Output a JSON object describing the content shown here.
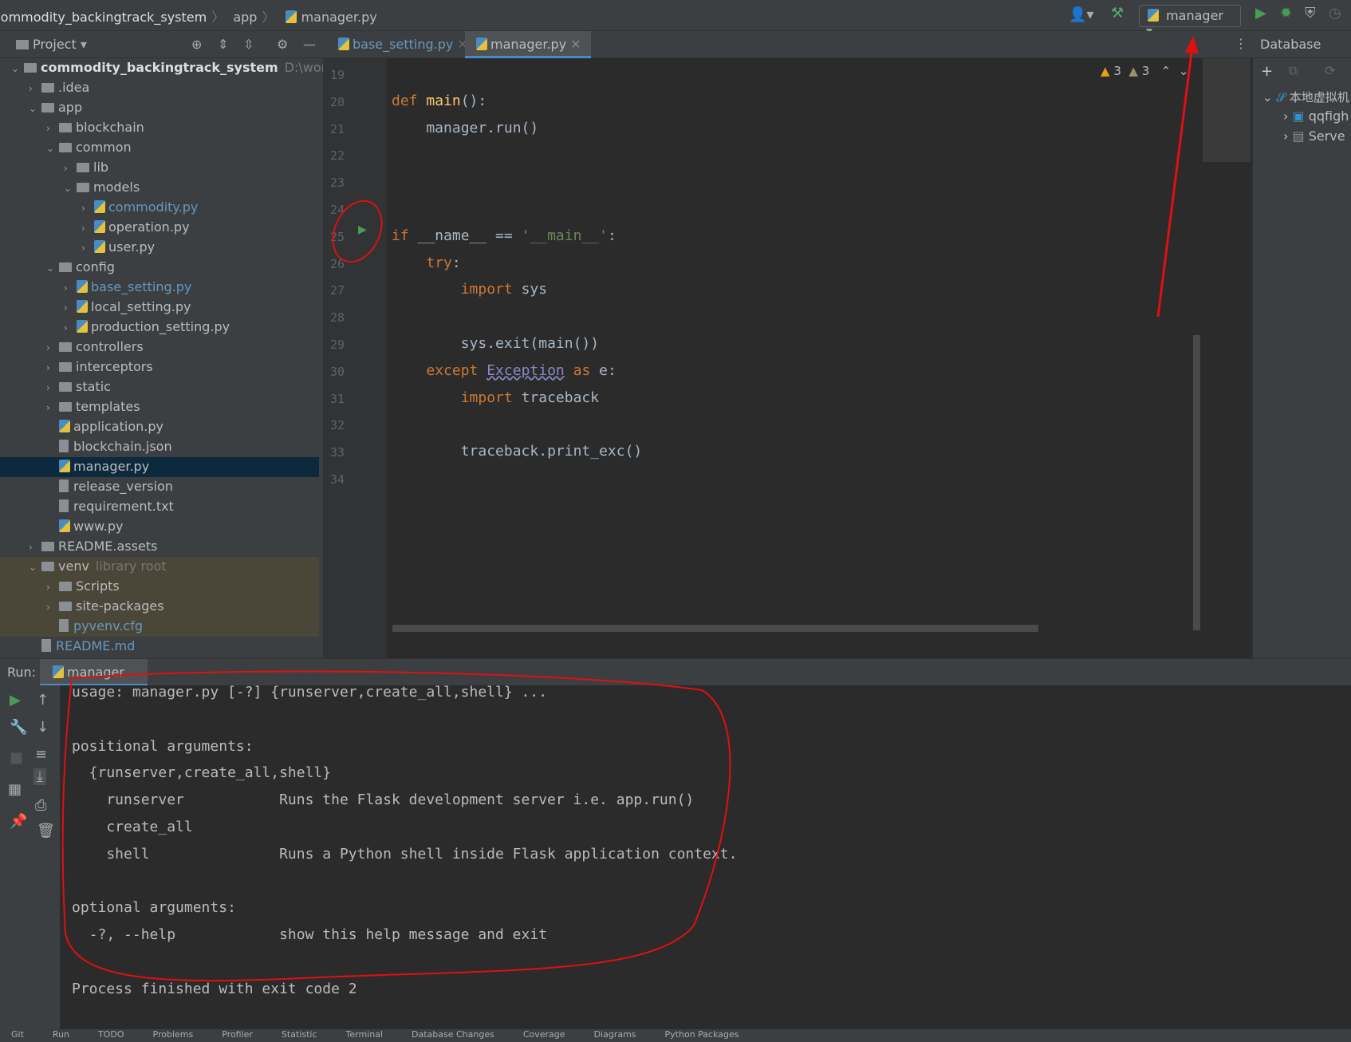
{
  "breadcrumb": [
    "commodity_backingtrack_system",
    "app",
    "manager.py"
  ],
  "run_config": "manager",
  "tabs": [
    {
      "label": "base_setting.py",
      "active": false
    },
    {
      "label": "manager.py",
      "active": true
    }
  ],
  "project": {
    "title": "Project",
    "items": [
      {
        "label": "commodity_backingtrack_system",
        "suffix": "D:\\workspac",
        "depth": 0,
        "open": true,
        "type": "folder"
      },
      {
        "label": ".idea",
        "depth": 1,
        "type": "folder"
      },
      {
        "label": "app",
        "depth": 1,
        "open": true,
        "type": "folder"
      },
      {
        "label": "blockchain",
        "depth": 2,
        "type": "folder"
      },
      {
        "label": "common",
        "depth": 2,
        "open": true,
        "type": "folder"
      },
      {
        "label": "lib",
        "depth": 3,
        "type": "folder"
      },
      {
        "label": "models",
        "depth": 3,
        "open": true,
        "type": "folder"
      },
      {
        "label": "commodity.py",
        "depth": 4,
        "type": "py",
        "color": "#6897bb"
      },
      {
        "label": "operation.py",
        "depth": 4,
        "type": "py"
      },
      {
        "label": "user.py",
        "depth": 4,
        "type": "py"
      },
      {
        "label": "config",
        "depth": 2,
        "open": true,
        "type": "folder"
      },
      {
        "label": "base_setting.py",
        "depth": 3,
        "type": "py",
        "color": "#6897bb"
      },
      {
        "label": "local_setting.py",
        "depth": 3,
        "type": "py"
      },
      {
        "label": "production_setting.py",
        "depth": 3,
        "type": "py"
      },
      {
        "label": "controllers",
        "depth": 2,
        "type": "folder"
      },
      {
        "label": "interceptors",
        "depth": 2,
        "type": "folder"
      },
      {
        "label": "static",
        "depth": 2,
        "type": "folder"
      },
      {
        "label": "templates",
        "depth": 2,
        "type": "folder"
      },
      {
        "label": "application.py",
        "depth": 2,
        "type": "py",
        "leaf": true
      },
      {
        "label": "blockchain.json",
        "depth": 2,
        "type": "txt",
        "leaf": true
      },
      {
        "label": "manager.py",
        "depth": 2,
        "type": "py",
        "leaf": true,
        "selected": true
      },
      {
        "label": "release_version",
        "depth": 2,
        "type": "txt",
        "leaf": true
      },
      {
        "label": "requirement.txt",
        "depth": 2,
        "type": "txt",
        "leaf": true
      },
      {
        "label": "www.py",
        "depth": 2,
        "type": "py",
        "leaf": true
      },
      {
        "label": "README.assets",
        "depth": 1,
        "type": "folder"
      },
      {
        "label": "venv",
        "suffix": "library root",
        "depth": 1,
        "open": true,
        "type": "folder",
        "venv": true
      },
      {
        "label": "Scripts",
        "depth": 2,
        "type": "folder",
        "venv": true
      },
      {
        "label": "site-packages",
        "depth": 2,
        "type": "folder",
        "venv": true
      },
      {
        "label": "pyvenv.cfg",
        "depth": 2,
        "type": "txt",
        "leaf": true,
        "venv": true,
        "color": "#6897bb"
      },
      {
        "label": "README.md",
        "depth": 1,
        "type": "txt",
        "leaf": true,
        "color": "#6897bb"
      }
    ]
  },
  "editor": {
    "warnings": [
      "3",
      "3"
    ],
    "lines": [
      {
        "n": "19",
        "html": ""
      },
      {
        "n": "20",
        "html": "<span class='kw'>def </span><span class='fn'>main</span>():"
      },
      {
        "n": "21",
        "html": "    manager.run()"
      },
      {
        "n": "22",
        "html": ""
      },
      {
        "n": "23",
        "html": ""
      },
      {
        "n": "24",
        "html": ""
      },
      {
        "n": "25",
        "html": "<span class='kw'>if </span>__name__ == <span class='str'>'__main__'</span>:"
      },
      {
        "n": "26",
        "html": "    <span class='kw'>try</span>:"
      },
      {
        "n": "27",
        "html": "        <span class='kw'>import </span>sys"
      },
      {
        "n": "28",
        "html": ""
      },
      {
        "n": "29",
        "html": "        sys.exit(main())"
      },
      {
        "n": "30",
        "html": "    <span class='kw'>except </span><span class='cls'>Exception</span><span class='kw'> as </span>e:"
      },
      {
        "n": "31",
        "html": "        <span class='kw'>import </span>traceback"
      },
      {
        "n": "32",
        "html": ""
      },
      {
        "n": "33",
        "html": "        traceback.print_exc()"
      },
      {
        "n": "34",
        "html": ""
      }
    ]
  },
  "database": {
    "title": "Database",
    "items": [
      "本地虚拟机",
      "qqfigh",
      "Serve"
    ]
  },
  "run": {
    "label": "Run:",
    "tab": "manager",
    "output": [
      "usage: manager.py [-?] {runserver,create_all,shell} ...",
      "",
      "positional arguments:",
      "  {runserver,create_all,shell}",
      "    runserver           Runs the Flask development server i.e. app.run()",
      "    create_all",
      "    shell               Runs a Python shell inside Flask application context.",
      "",
      "optional arguments:",
      "  -?, --help            show this help message and exit",
      "",
      "Process finished with exit code 2"
    ]
  },
  "statusbar": [
    "Git",
    "Run",
    "TODO",
    "Problems",
    "Profiler",
    "Statistic",
    "Terminal",
    "Database Changes",
    "Coverage",
    "Diagrams",
    "Python Packages"
  ]
}
